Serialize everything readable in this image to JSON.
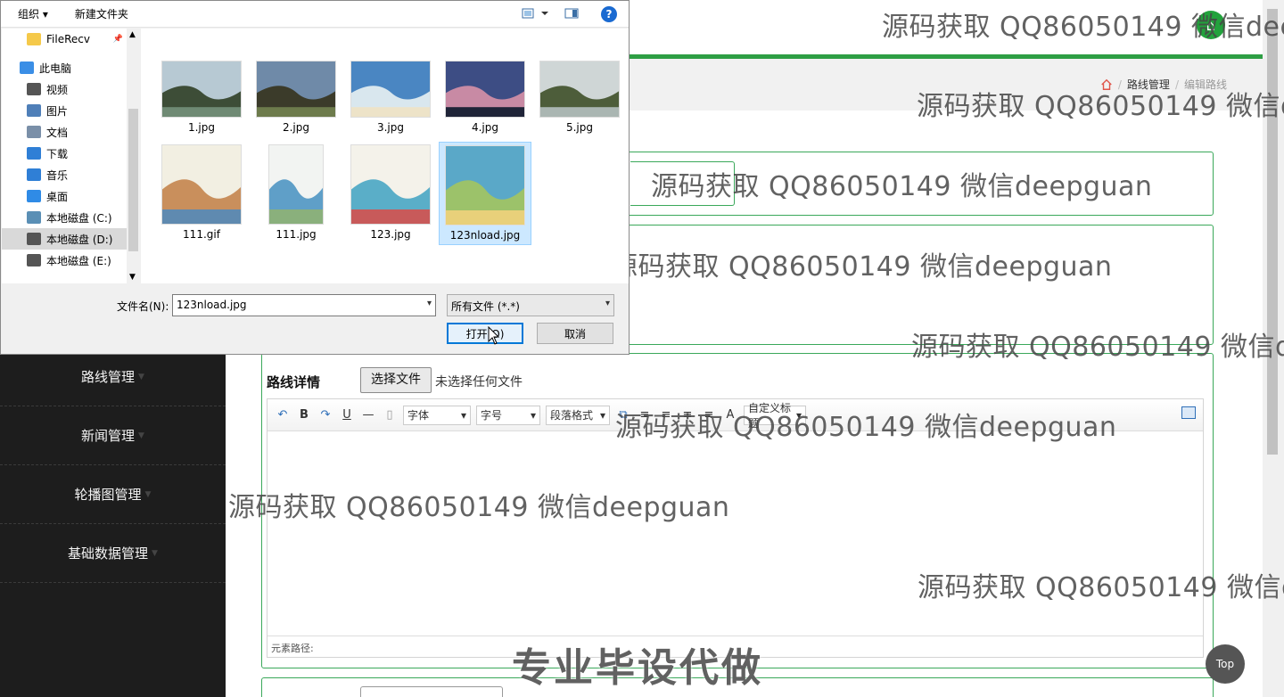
{
  "header": {
    "avatar_glyph": "⌂"
  },
  "breadcrumb": {
    "level1": "路线管理",
    "separator": "/",
    "current": "编辑路线"
  },
  "sidebar": {
    "items": [
      {
        "label": "路线管理"
      },
      {
        "label": "新闻管理"
      },
      {
        "label": "轮播图管理"
      },
      {
        "label": "基础数据管理"
      }
    ]
  },
  "form": {
    "detail_label": "路线详情",
    "file_button": "选择文件",
    "file_status": "未选择任何文件"
  },
  "editor": {
    "font_family_placeholder": "字体",
    "font_size_placeholder": "字号",
    "paragraph_placeholder": "段落格式",
    "custom_title": "自定义标题",
    "status_path": "元素路径:"
  },
  "top_button": "Top",
  "watermarks": {
    "text_long": "源码获取 QQ86050149 微信deepguan",
    "text_cut1": "源码获取 QQ86050149 微信dee",
    "text_cut2": "源码获取 QQ86050149 微信d"
  },
  "promo": "专业毕设代做",
  "dialog": {
    "organize": "组织 ▾",
    "new_folder": "新建文件夹",
    "help": "?",
    "nav_items": [
      {
        "label": "FileRecv",
        "icon": "folder-icon",
        "color": "#f5c94a"
      },
      {
        "label": "此电脑",
        "icon": "computer-icon",
        "color": "#3a8ee6"
      },
      {
        "label": "视频",
        "icon": "video-icon",
        "color": "#555555"
      },
      {
        "label": "图片",
        "icon": "pictures-icon",
        "color": "#4f7fb8"
      },
      {
        "label": "文档",
        "icon": "documents-icon",
        "color": "#7a8fa8"
      },
      {
        "label": "下载",
        "icon": "download-icon",
        "color": "#2f7fd6"
      },
      {
        "label": "音乐",
        "icon": "music-icon",
        "color": "#2f7fd6"
      },
      {
        "label": "桌面",
        "icon": "desktop-icon",
        "color": "#2f8be6"
      },
      {
        "label": "本地磁盘 (C:)",
        "icon": "drive-icon",
        "color": "#5a8fb5"
      },
      {
        "label": "本地磁盘 (D:)",
        "icon": "drive-icon",
        "color": "#555555"
      },
      {
        "label": "本地磁盘 (E:)",
        "icon": "drive-icon",
        "color": "#555555"
      }
    ],
    "files": [
      {
        "name": "1.jpg",
        "colors": [
          "#b7c9d3",
          "#3d4d37",
          "#6f8a74"
        ]
      },
      {
        "name": "2.jpg",
        "colors": [
          "#6f8aa8",
          "#3b3b2a",
          "#6d7b4c"
        ]
      },
      {
        "name": "3.jpg",
        "colors": [
          "#4a86c2",
          "#d9e7ee",
          "#ede3c8"
        ]
      },
      {
        "name": "4.jpg",
        "colors": [
          "#3d4d84",
          "#c88aa4",
          "#1f2438"
        ]
      },
      {
        "name": "5.jpg",
        "colors": [
          "#cfd6d6",
          "#4d5d3a",
          "#aab6b2"
        ]
      },
      {
        "name": "111.gif",
        "colors": [
          "#f2efe2",
          "#c98f5c",
          "#5f8ab0"
        ]
      },
      {
        "name": "111.jpg",
        "colors": [
          "#f2f4f2",
          "#5f9fc8",
          "#8ab07c"
        ]
      },
      {
        "name": "123.jpg",
        "colors": [
          "#f4f2ea",
          "#5aaec8",
          "#c85a5a"
        ]
      },
      {
        "name": "123nload.jpg",
        "colors": [
          "#5aa8c8",
          "#9cc26a",
          "#e8d07a"
        ]
      }
    ],
    "filename_label": "文件名(N):",
    "filename_value": "123nload.jpg",
    "filetype_value": "所有文件 (*.*)",
    "open_button": "打开(O)",
    "cancel_button": "取消"
  }
}
